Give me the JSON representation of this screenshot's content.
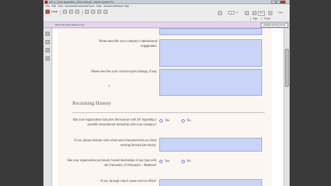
{
  "window": {
    "title": "NGLA_Grant Application_2004_final.pdf - Adobe Acrobat Pro"
  },
  "menu": [
    "File",
    "Edit",
    "View",
    "Document",
    "Comments",
    "Forms",
    "Tools",
    "Advanced",
    "Window",
    "Help"
  ],
  "toolbar": {
    "create_label": "Create",
    "page_current": "2",
    "page_total": "/ 6",
    "zoom": "75%",
    "find_label": "Find",
    "sign_label": "Sign",
    "forms_label": "Forms"
  },
  "formbar": {
    "message": "Please fill out the following form.",
    "highlight_label": "Highlight Existing Fields"
  },
  "form": {
    "q_engagement": "Please describe your company's international engagement.",
    "q_export": "Please describe your current export strategy, if any.",
    "page_marker": "2",
    "recruiting_heading": "Recruiting History",
    "q_discussions": "Has your organization had prior discussions with UF regarding a possible international internship with your company?",
    "q_discussions_detail": "If yes, please indicate with whom and what perceived you from moving forward previously.",
    "q_relationship": "Has your organization previously hosted internships of any type with the University of Wisconsin – Madison?",
    "q_career": "If yes, through which career service office?",
    "yes_label": "Yes",
    "no_label": "No"
  },
  "colors": {
    "field_fill": "#c9d4f6",
    "form_bar": "#e3d5ec",
    "title_icon": "#b01e1e"
  }
}
